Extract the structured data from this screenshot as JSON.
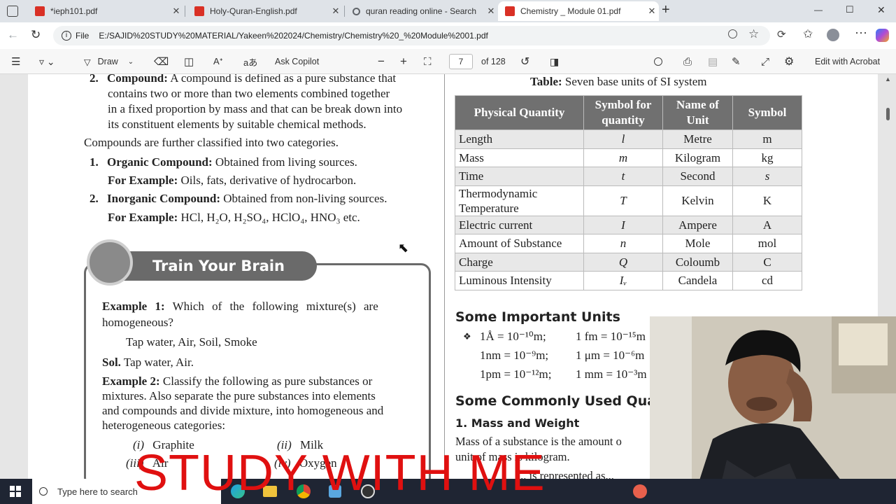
{
  "tabs": [
    {
      "title": "*ieph101.pdf",
      "type": "pdf",
      "active": false
    },
    {
      "title": "Holy-Quran-English.pdf",
      "type": "pdf",
      "active": false
    },
    {
      "title": "quran reading online - Search",
      "type": "search",
      "active": false
    },
    {
      "title": "Chemistry _ Module 01.pdf",
      "type": "pdf",
      "active": true
    }
  ],
  "new_tab_label": "+",
  "window": {
    "minimize": "—",
    "maximize": "☐",
    "close": "✕"
  },
  "address": {
    "scheme_label": "File",
    "url": "E:/SAJID%20STUDY%20MATERIAL/Yakeen%202024/Chemistry/Chemistry%20_%20Module%2001.pdf"
  },
  "pdf_toolbar": {
    "draw": "Draw",
    "ask_copilot": "Ask Copilot",
    "zoom_out": "−",
    "zoom_in": "+",
    "page_current": "7",
    "page_total": "of 128",
    "edit_acrobat": "Edit with Acrobat"
  },
  "left_column": {
    "item2_num": "2.",
    "item2_bold": "Compound:",
    "item2_l1": " A compound is defined as a pure substance that",
    "item2_l2": "contains two or more than two elements combined together",
    "item2_l3": "in a fixed proportion by mass and that can be break down into",
    "item2_l4": "its constituent elements by suitable chemical methods.",
    "classified": "Compounds are further classified into two categories.",
    "org_num": "1.",
    "org_bold": "Organic Compound:",
    "org_text": " Obtained from living sources.",
    "org_ex_bold": "For Example:",
    "org_ex_text": " Oils, fats, derivative of hydrocarbon.",
    "inorg_num": "2.",
    "inorg_bold": "Inorganic Compound:",
    "inorg_text": " Obtained from non-living sources.",
    "inorg_ex_bold": "For Example:",
    "inorg_ex_text": " HCl, H₂O, H₂SO₄, HClO₄, HNO₃ etc."
  },
  "train_brain": {
    "title": "Train Your Brain",
    "ex1_bold": "Example 1:",
    "ex1_text": " Which of the following mixture(s) are",
    "ex1_text2": "homogeneous?",
    "ex1_options": "Tap water, Air, Soil, Smoke",
    "sol_bold": "Sol.",
    "sol_text": " Tap water, Air.",
    "ex2_bold": "Example 2:",
    "ex2_l1": " Classify the following as pure substances or",
    "ex2_l2": "mixtures. Also separate the pure substances into elements",
    "ex2_l3": "and compounds and divide mixture, into homogeneous and",
    "ex2_l4": "heterogeneous categories:",
    "opt_i": "(i)",
    "opt_i_text": "Graphite",
    "opt_ii": "(ii)",
    "opt_ii_text": "Milk",
    "opt_iii": "(iii)",
    "opt_iii_text": "Air",
    "opt_iv": "(iv)",
    "opt_iv_text": "Oxygen"
  },
  "table": {
    "caption_bold": "Table:",
    "caption_text": " Seven base units of SI system",
    "headers": [
      "Physical Quantity",
      "Symbol for quantity",
      "Name of Unit",
      "Symbol"
    ],
    "rows": [
      [
        "Length",
        "l",
        "Metre",
        "m"
      ],
      [
        "Mass",
        "m",
        "Kilogram",
        "kg"
      ],
      [
        "Time",
        "t",
        "Second",
        "s"
      ],
      [
        "Thermodynamic Temperature",
        "T",
        "Kelvin",
        "K"
      ],
      [
        "Electric current",
        "I",
        "Ampere",
        "A"
      ],
      [
        "Amount of Substance",
        "n",
        "Mole",
        "mol"
      ],
      [
        "Charge",
        "Q",
        "Coloumb",
        "C"
      ],
      [
        "Luminous Intensity",
        "Iᵥ",
        "Candela",
        "cd"
      ]
    ]
  },
  "right_column": {
    "units_heading": "Some Important Units",
    "u1a": "1Å = 10⁻¹⁰m;",
    "u1b": "1 fm = 10⁻¹⁵m",
    "u2a": "1nm = 10⁻⁹m;",
    "u2b": "1 μm = 10⁻⁶m",
    "u3a": "1pm = 10⁻¹²m;",
    "u3b": "1 mm = 10⁻³m",
    "common_heading": "Some Commonly Used Quan",
    "mass_heading": "1. Mass and Weight",
    "mass_l1": "Mass of a substance is the amount o",
    "mass_l2": "unit of mass is kilogram.",
    "mass_l3": "... is represented as..."
  },
  "taskbar": {
    "search_placeholder": "Type here to search"
  },
  "overlay_text": "STUDY WITH ME",
  "colors": {
    "table_header": "#707070",
    "overlay": "#e01010",
    "pdf_tab": "#d93025"
  }
}
